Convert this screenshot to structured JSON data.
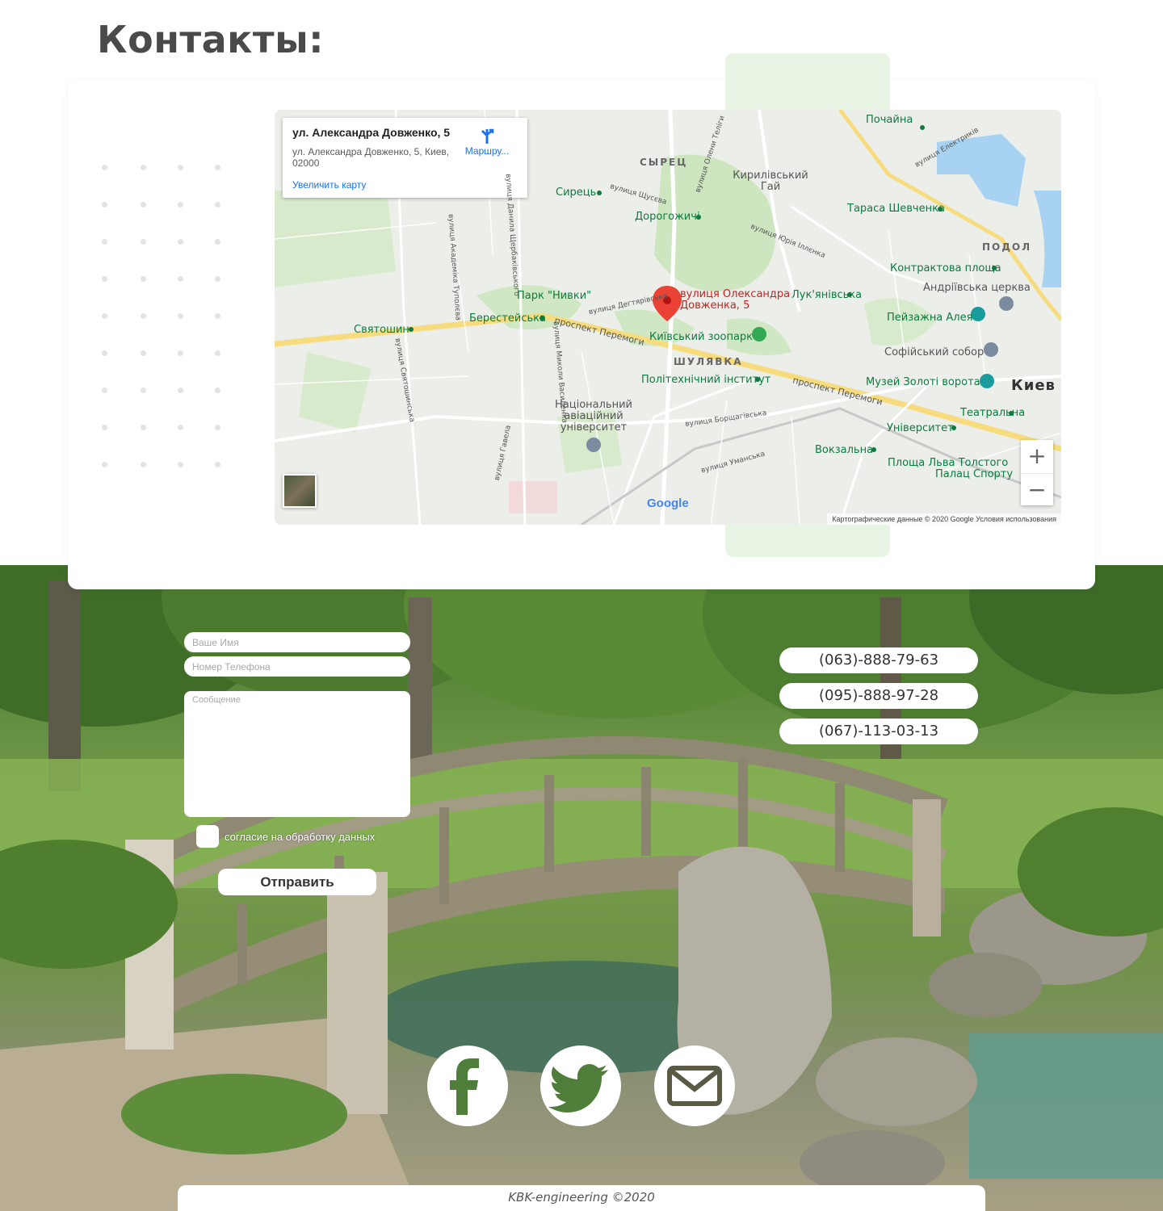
{
  "page": {
    "title": "Контакты:"
  },
  "map": {
    "place_title": "ул. Александра Довженко, 5",
    "place_address": "ул. Александра Довженко, 5, Киев, 02000",
    "route_label": "Маршру...",
    "enlarge_label": "Увеличить карту",
    "zoom_in": "+",
    "zoom_out": "−",
    "google_logo": "Google",
    "attribution": "Картографические данные © 2020 Google   Условия использования",
    "marker_label": "вулиця Олександра Довженка, 5",
    "labels": {
      "pochaina": "Почайна",
      "syrets_district": "СЫРЕЦ",
      "kyrylivskyi": "Кирилівський Гай",
      "syrets": "Сирець",
      "dorohozhychi": "Дорогожичі",
      "tarasa": "Тараса Шевченка",
      "podil": "ПОДОЛ",
      "kontraktova": "Контрактова площа",
      "andriivska": "Андріївська церква",
      "park_nyvky": "Парк \"Нивки\"",
      "lukianivska": "Лук'янівська",
      "peizazhna": "Пейзажна Алея",
      "sviatoshyn": "Святошин",
      "beresteiska": "Берестейська",
      "prospekt1": "проспект Перемоги",
      "zoo": "Київський зоопарк",
      "sofiiskyi": "Софійський собор",
      "shuliavka": "ШУЛЯВКА",
      "politekh": "Політехнічний інститут",
      "prospekt2": "проспект Перемоги",
      "zoloti": "Музей Золоті ворота",
      "kyiv": "Киев",
      "nau": "Національний авіаційний університет",
      "teatralna": "Театральна",
      "universytet": "Університет",
      "vokzalna": "Вокзальна",
      "tolstoho": "Площа Льва Толстого",
      "palats": "Палац Спорту",
      "street_dehtiarivska": "вулиця Дегтярівська",
      "street_borshchahivska": "вулиця Борщагівська",
      "street_umanska": "вулиця Уманська",
      "street_shchusieva": "вулиця Щусєва",
      "street_illienka": "вулиця Юрія Іллєнка",
      "street_telihy": "вулиця Олени Теліги",
      "street_elektrykiv": "вулиця Електриків",
      "street_shcherbakivskoho": "вулиця Данила Щербаківського",
      "street_tupoleva": "вулиця Академіка Туполєва",
      "street_sviatoshynska": "вулиця Святошинська",
      "street_vasylkivska": "вулиця Миколи Василенка",
      "street_havela": "вулиця Гавела"
    }
  },
  "form": {
    "name_placeholder": "Ваше Имя",
    "phone_placeholder": "Номер Телефона",
    "message_placeholder": "Сообщение",
    "consent_label": "согласие на обработку данных",
    "submit_label": "Отправить"
  },
  "phones": [
    "(063)-888-79-63",
    "(095)-888-97-28",
    "(067)-113-03-13"
  ],
  "social": {
    "icons": [
      "facebook-icon",
      "twitter-icon",
      "mail-icon"
    ]
  },
  "footer": {
    "text": "KBK-engineering ©2020"
  },
  "colors": {
    "map_marker": "#c5221f",
    "metro_green": "#0b7b3e",
    "map_link": "#1a73e8",
    "accent_green": "#e8f4e3"
  }
}
